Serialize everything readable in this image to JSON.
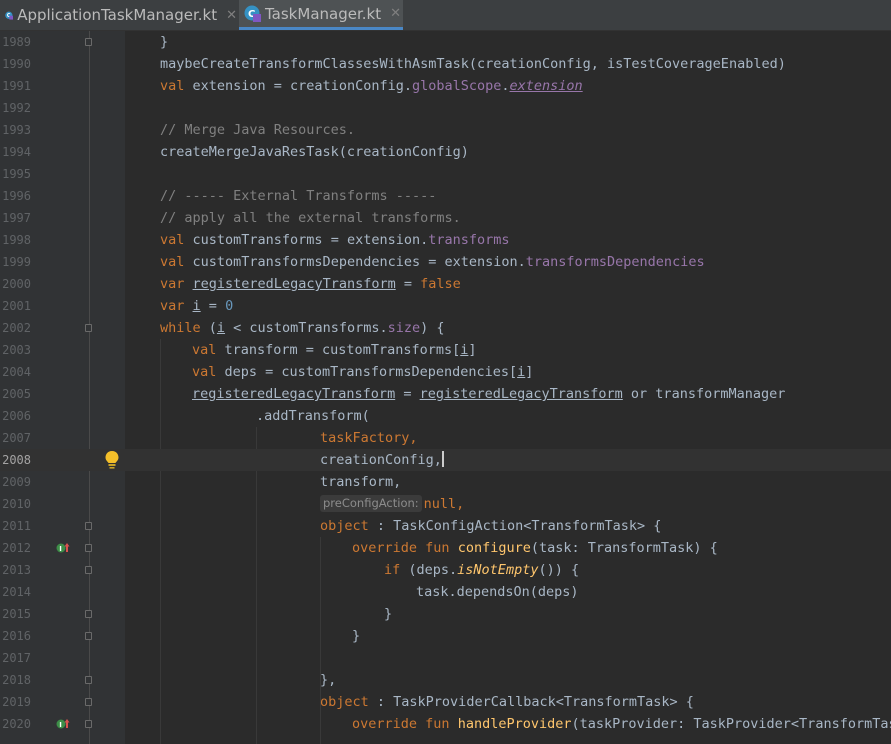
{
  "tabs": [
    {
      "label": "ApplicationTaskManager.kt",
      "close": "✕",
      "active": false
    },
    {
      "label": "TaskManager.kt",
      "close": "✕",
      "active": true
    }
  ],
  "lines": [
    {
      "num": "1989",
      "code": "}"
    },
    {
      "num": "1990",
      "code": "maybeCreateTransformClassesWithAsmTask(creationConfig, isTestCoverageEnabled)"
    },
    {
      "num": "1991",
      "code": "val extension = creationConfig.globalScope.extension"
    },
    {
      "num": "1992",
      "code": ""
    },
    {
      "num": "1993",
      "code": "// Merge Java Resources."
    },
    {
      "num": "1994",
      "code": "createMergeJavaResTask(creationConfig)"
    },
    {
      "num": "1995",
      "code": ""
    },
    {
      "num": "1996",
      "code": "// ----- External Transforms -----"
    },
    {
      "num": "1997",
      "code": "// apply all the external transforms."
    },
    {
      "num": "1998",
      "code": "val customTransforms = extension.transforms"
    },
    {
      "num": "1999",
      "code": "val customTransformsDependencies = extension.transformsDependencies"
    },
    {
      "num": "2000",
      "code": "var registeredLegacyTransform = false"
    },
    {
      "num": "2001",
      "code": "var i = 0"
    },
    {
      "num": "2002",
      "code": "while (i < customTransforms.size) {"
    },
    {
      "num": "2003",
      "code": "val transform = customTransforms[i]"
    },
    {
      "num": "2004",
      "code": "val deps = customTransformsDependencies[i]"
    },
    {
      "num": "2005",
      "code": "registeredLegacyTransform = registeredLegacyTransform or transformManager"
    },
    {
      "num": "2006",
      "code": ".addTransform("
    },
    {
      "num": "2007",
      "code": "taskFactory,"
    },
    {
      "num": "2008",
      "code": "creationConfig,"
    },
    {
      "num": "2009",
      "code": "transform,"
    },
    {
      "num": "2010",
      "code": "preConfigAction: null,"
    },
    {
      "num": "2011",
      "code": "object : TaskConfigAction<TransformTask> {"
    },
    {
      "num": "2012",
      "code": "override fun configure(task: TransformTask) {"
    },
    {
      "num": "2013",
      "code": "if (deps.isNotEmpty()) {"
    },
    {
      "num": "2014",
      "code": "task.dependsOn(deps)"
    },
    {
      "num": "2015",
      "code": "}"
    },
    {
      "num": "2016",
      "code": "}"
    },
    {
      "num": "2017",
      "code": ""
    },
    {
      "num": "2018",
      "code": "},"
    },
    {
      "num": "2019",
      "code": "object : TaskProviderCallback<TransformTask> {"
    },
    {
      "num": "2020",
      "code": "override fun handleProvider(taskProvider: TaskProvider<TransformTas"
    }
  ],
  "colors": {
    "background": "#2b2b2b",
    "keyword": "#cc7832",
    "function": "#ffc66d",
    "property": "#9876aa",
    "comment": "#808080",
    "number": "#6897bb",
    "text": "#a9b7c6",
    "tab_underline": "#4a88c7"
  },
  "icons": [
    "kotlin-file-icon",
    "close-icon",
    "fold-marker-icon",
    "implementing-method-icon",
    "intention-bulb-icon"
  ]
}
